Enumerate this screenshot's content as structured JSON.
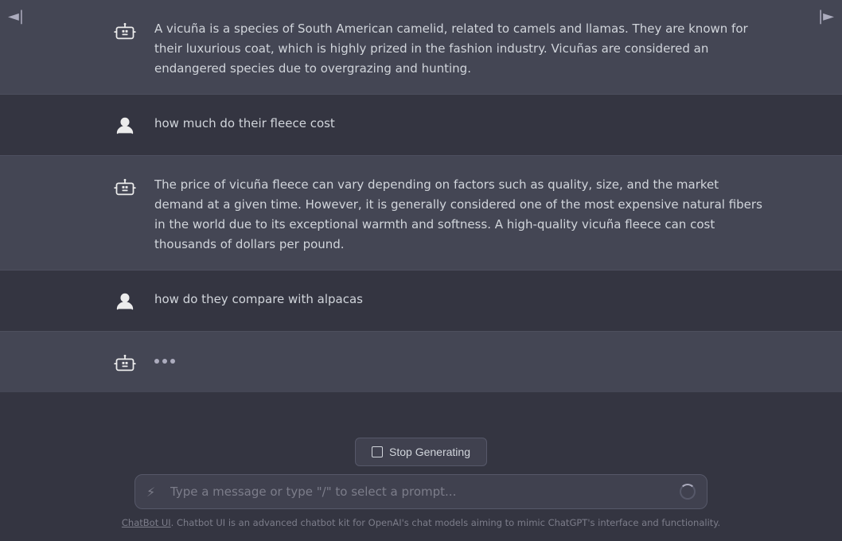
{
  "ui": {
    "collapse_left": "◄|",
    "collapse_right": "|►",
    "messages": [
      {
        "role": "assistant",
        "content": "A vicuña is a species of South American camelid, related to camels and llamas. They are known for their luxurious coat, which is highly prized in the fashion industry. Vicuñas are considered an endangered species due to overgrazing and hunting."
      },
      {
        "role": "user",
        "content": "how much do their fleece cost"
      },
      {
        "role": "assistant",
        "content": "The price of vicuña fleece can vary depending on factors such as quality, size, and the market demand at a given time. However, it is generally considered one of the most expensive natural fibers in the world due to its exceptional warmth and softness. A high-quality vicuña fleece can cost thousands of dollars per pound."
      },
      {
        "role": "user",
        "content": "how do they compare with alpacas"
      },
      {
        "role": "assistant",
        "content": "...",
        "typing": true
      }
    ],
    "stop_button": {
      "label": "Stop Generating"
    },
    "input": {
      "placeholder": "Type a message or type \"/\" to select a prompt..."
    },
    "footer": {
      "link_text": "ChatBot UI",
      "text": ". Chatbot UI is an advanced chatbot kit for OpenAI's chat models aiming to mimic ChatGPT's interface and functionality."
    }
  }
}
